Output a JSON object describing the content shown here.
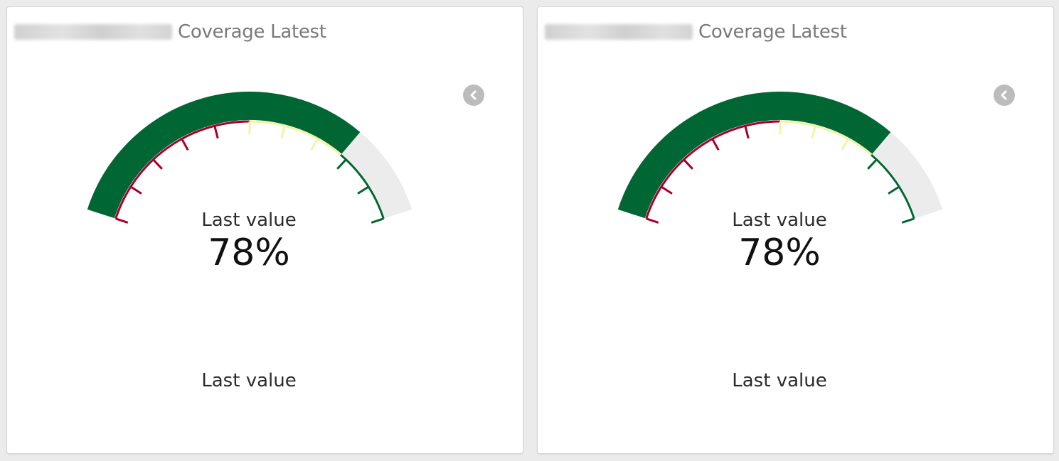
{
  "widgets": [
    {
      "title": "Coverage Latest",
      "gauge_label": "Last value",
      "value_text": "78%",
      "footer_label": "Last value",
      "value": 78
    },
    {
      "title": "Coverage Latest",
      "gauge_label": "Last value",
      "value_text": "78%",
      "footer_label": "Last value",
      "value": 78
    }
  ],
  "colors": {
    "value_fill": "#006633",
    "remaining_track": "#ececec",
    "band_low": "#a5002b",
    "band_mid": "#f3f3a6",
    "band_high": "#006633"
  },
  "icons": [
    "chevron-left-icon"
  ]
}
